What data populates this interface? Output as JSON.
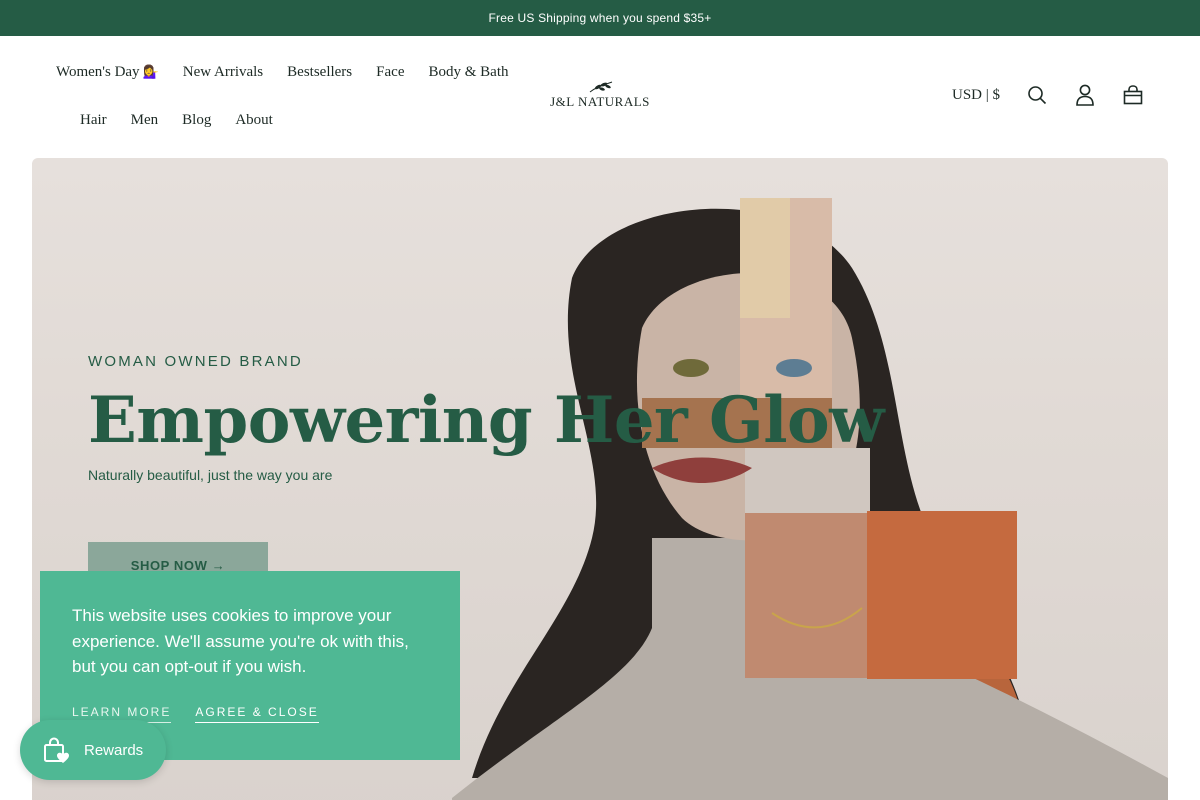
{
  "announcement": {
    "text": "Free US Shipping when you spend $35+"
  },
  "nav": {
    "row1": [
      {
        "label": "Women's Day",
        "emoji": "💁‍♀️"
      },
      {
        "label": "New Arrivals"
      },
      {
        "label": "Bestsellers"
      },
      {
        "label": "Face"
      },
      {
        "label": "Body & Bath"
      }
    ],
    "row2": [
      {
        "label": "Hair"
      },
      {
        "label": "Men"
      },
      {
        "label": "Blog"
      },
      {
        "label": "About"
      }
    ]
  },
  "logo": {
    "text": "J&L NATURALS"
  },
  "header_tools": {
    "currency": "USD | $",
    "icons": [
      "search-icon",
      "account-icon",
      "cart-icon"
    ]
  },
  "hero": {
    "eyebrow": "WOMAN OWNED BRAND",
    "title": "Empowering Her Glow",
    "subtitle": "Naturally beautiful, just the way you are",
    "cta": "SHOP NOW →"
  },
  "cookie": {
    "text": "This website uses cookies to improve your experience. We'll assume you're ok with this, but you can opt-out if you wish.",
    "learn_more": "LEARN MORE",
    "agree": "AGREE & CLOSE"
  },
  "rewards": {
    "label": "Rewards",
    "icon": "shopping-bag-heart-icon"
  },
  "colors": {
    "brand_green": "#255c45",
    "accent_mint": "#4fb894",
    "button_sage": "#8ba79a",
    "hero_bg": "#e3ddd8"
  }
}
